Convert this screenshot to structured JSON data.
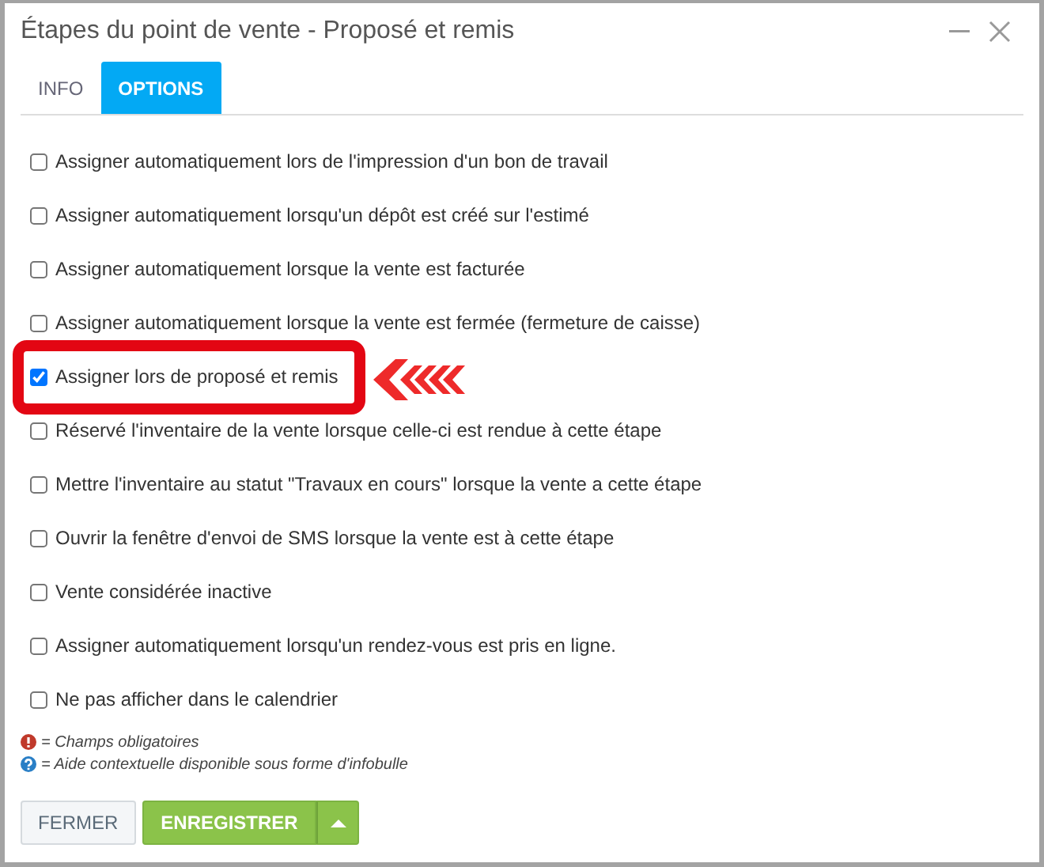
{
  "window": {
    "title": "Étapes du point de vente - Proposé et remis"
  },
  "tabs": [
    {
      "label": "INFO",
      "selected": false
    },
    {
      "label": "OPTIONS",
      "selected": true
    }
  ],
  "options": [
    {
      "label": "Assigner automatiquement lors de l'impression d'un bon de travail",
      "checked": false,
      "highlighted": false
    },
    {
      "label": "Assigner automatiquement lorsqu'un dépôt est créé sur l'estimé",
      "checked": false,
      "highlighted": false
    },
    {
      "label": "Assigner automatiquement lorsque la vente est facturée",
      "checked": false,
      "highlighted": false
    },
    {
      "label": "Assigner automatiquement lorsque la vente est fermée (fermeture de caisse)",
      "checked": false,
      "highlighted": false
    },
    {
      "label": "Assigner lors de proposé et remis",
      "checked": true,
      "highlighted": true
    },
    {
      "label": "Réservé l'inventaire de la vente lorsque celle-ci est rendue à cette étape",
      "checked": false,
      "highlighted": false
    },
    {
      "label": "Mettre l'inventaire au statut \"Travaux en cours\" lorsque la vente a cette étape",
      "checked": false,
      "highlighted": false
    },
    {
      "label": "Ouvrir la fenêtre d'envoi de SMS lorsque la vente est à cette étape",
      "checked": false,
      "highlighted": false
    },
    {
      "label": "Vente considérée inactive",
      "checked": false,
      "highlighted": false
    },
    {
      "label": "Assigner automatiquement lorsqu'un rendez-vous est pris en ligne.",
      "checked": false,
      "highlighted": false
    },
    {
      "label": "Ne pas afficher dans le calendrier",
      "checked": false,
      "highlighted": false
    }
  ],
  "legend": [
    {
      "kind": "required",
      "text": "= Champs obligatoires"
    },
    {
      "kind": "help",
      "text": "= Aide contextuelle disponible sous forme d'infobulle"
    }
  ],
  "buttons": {
    "close": "FERMER",
    "save": "ENREGISTRER"
  }
}
